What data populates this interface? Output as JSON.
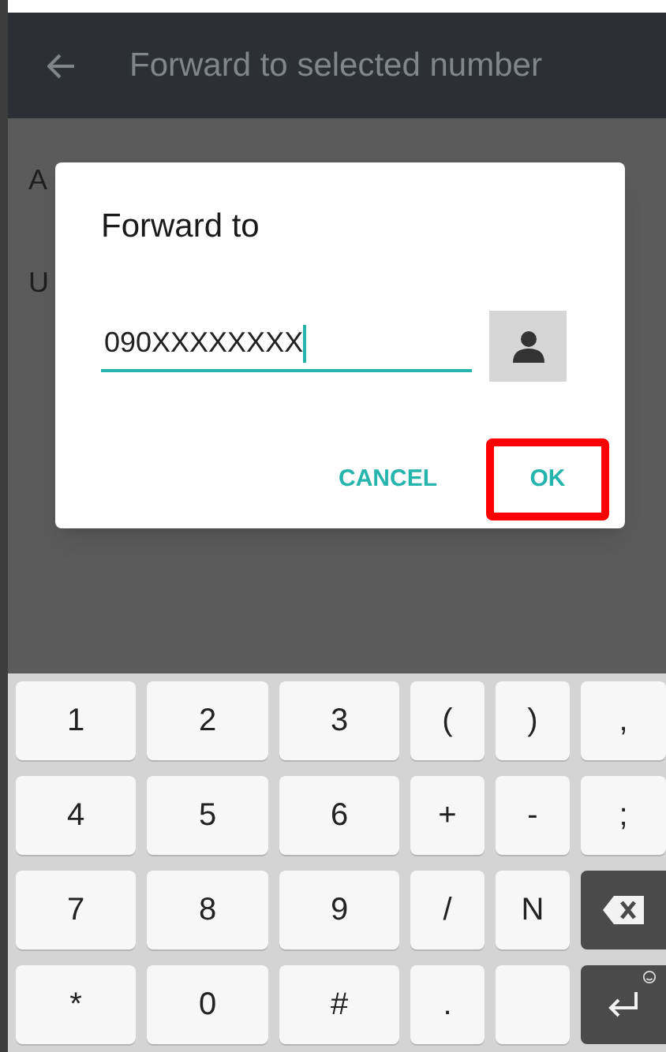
{
  "app_bar": {
    "title": "Forward to selected number"
  },
  "background_items": [
    "A",
    "U"
  ],
  "dialog": {
    "title": "Forward to",
    "field": {
      "value": "090XXXXXXXX",
      "focused": true
    },
    "buttons": [
      {
        "label": "CANCEL",
        "highlighted": false
      },
      {
        "label": "OK",
        "highlighted": true
      }
    ]
  },
  "keyboard": {
    "rows": [
      [
        {
          "kind": "char",
          "label": "1"
        },
        {
          "kind": "char",
          "label": "2"
        },
        {
          "kind": "char",
          "label": "3"
        },
        {
          "kind": "char",
          "label": "("
        },
        {
          "kind": "char",
          "label": ")"
        },
        {
          "kind": "char",
          "label": ","
        }
      ],
      [
        {
          "kind": "char",
          "label": "4"
        },
        {
          "kind": "char",
          "label": "5"
        },
        {
          "kind": "char",
          "label": "6"
        },
        {
          "kind": "char",
          "label": "+"
        },
        {
          "kind": "char",
          "label": "-"
        },
        {
          "kind": "char",
          "label": ";"
        }
      ],
      [
        {
          "kind": "char",
          "label": "7"
        },
        {
          "kind": "char",
          "label": "8"
        },
        {
          "kind": "char",
          "label": "9"
        },
        {
          "kind": "char",
          "label": "/"
        },
        {
          "kind": "char",
          "label": "N"
        },
        {
          "kind": "backspace"
        }
      ],
      [
        {
          "kind": "char",
          "label": "*"
        },
        {
          "kind": "char",
          "label": "0"
        },
        {
          "kind": "char",
          "label": "#"
        },
        {
          "kind": "char",
          "label": "."
        },
        {
          "kind": "blank"
        },
        {
          "kind": "enter"
        }
      ]
    ]
  }
}
